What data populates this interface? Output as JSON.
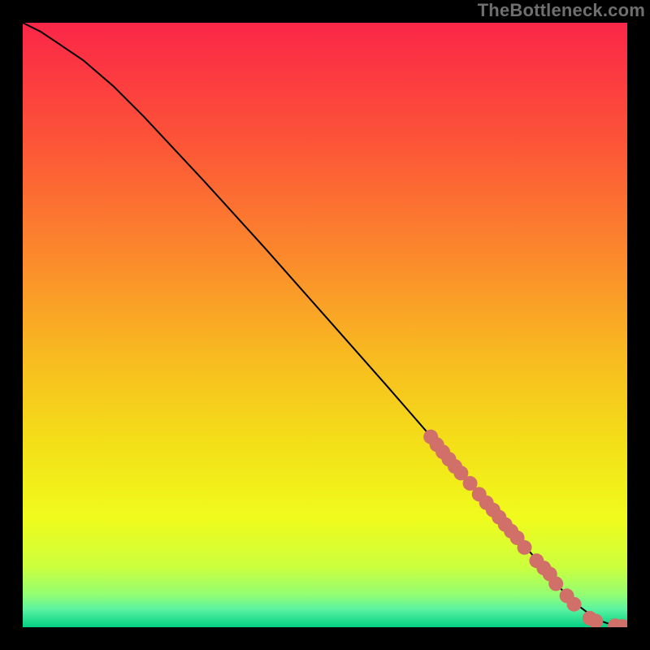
{
  "attribution": "TheBottleneck.com",
  "gradient": {
    "stops": [
      {
        "offset": 0.0,
        "color": "#fb2648"
      },
      {
        "offset": 0.2,
        "color": "#fc5537"
      },
      {
        "offset": 0.4,
        "color": "#fb8d2b"
      },
      {
        "offset": 0.55,
        "color": "#f8ba20"
      },
      {
        "offset": 0.7,
        "color": "#f3e018"
      },
      {
        "offset": 0.82,
        "color": "#f0fb1c"
      },
      {
        "offset": 0.9,
        "color": "#ccff3d"
      },
      {
        "offset": 0.945,
        "color": "#94fe71"
      },
      {
        "offset": 0.97,
        "color": "#5bf3a1"
      },
      {
        "offset": 1.0,
        "color": "#03d083"
      }
    ]
  },
  "chart_data": {
    "type": "line",
    "title": "",
    "xlabel": "",
    "ylabel": "",
    "xlim": [
      0,
      100
    ],
    "ylim": [
      0,
      100
    ],
    "series": [
      {
        "name": "curve",
        "x": [
          0,
          3,
          6,
          10,
          15,
          20,
          30,
          40,
          50,
          60,
          68,
          72,
          76,
          80,
          83,
          86,
          88,
          90,
          92,
          94,
          96,
          98,
          100
        ],
        "y": [
          100,
          98.5,
          96.5,
          93.8,
          89.5,
          84.5,
          73.8,
          62.8,
          51.5,
          40.2,
          31,
          26.3,
          21.5,
          17,
          13.5,
          10,
          7.5,
          5.3,
          3.5,
          2,
          0.9,
          0.25,
          0.1
        ]
      }
    ],
    "markers": {
      "name": "dots",
      "color": "#d07069",
      "radius_px": 9,
      "points": [
        {
          "x": 67.5,
          "y": 31.5
        },
        {
          "x": 68.5,
          "y": 30.2
        },
        {
          "x": 69.5,
          "y": 29.0
        },
        {
          "x": 70.5,
          "y": 27.8
        },
        {
          "x": 71.5,
          "y": 26.6
        },
        {
          "x": 72.5,
          "y": 25.5
        },
        {
          "x": 74.0,
          "y": 23.8
        },
        {
          "x": 75.5,
          "y": 22.0
        },
        {
          "x": 76.7,
          "y": 20.6
        },
        {
          "x": 77.8,
          "y": 19.4
        },
        {
          "x": 78.8,
          "y": 18.2
        },
        {
          "x": 79.8,
          "y": 17.0
        },
        {
          "x": 80.8,
          "y": 15.9
        },
        {
          "x": 81.8,
          "y": 14.8
        },
        {
          "x": 83.0,
          "y": 13.2
        },
        {
          "x": 85.0,
          "y": 11.0
        },
        {
          "x": 86.2,
          "y": 9.8
        },
        {
          "x": 87.2,
          "y": 8.8
        },
        {
          "x": 88.2,
          "y": 7.2
        },
        {
          "x": 90.0,
          "y": 5.2
        },
        {
          "x": 91.2,
          "y": 3.8
        },
        {
          "x": 93.8,
          "y": 1.5
        },
        {
          "x": 94.8,
          "y": 1.0
        },
        {
          "x": 98.0,
          "y": 0.25
        },
        {
          "x": 99.2,
          "y": 0.15
        }
      ]
    }
  }
}
